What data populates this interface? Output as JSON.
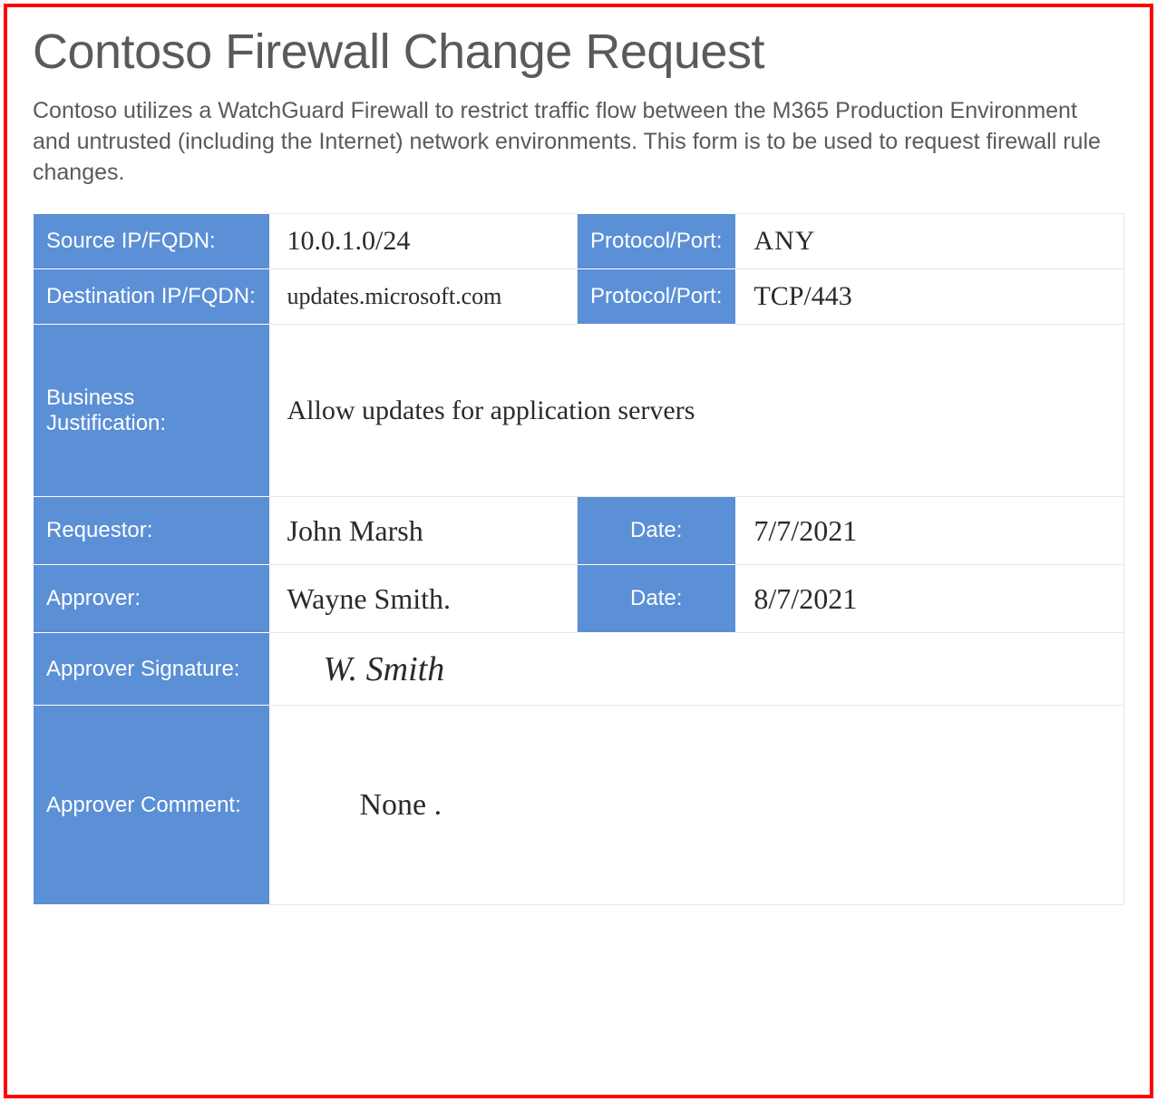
{
  "document": {
    "title": "Contoso Firewall Change Request",
    "description": "Contoso utilizes a WatchGuard Firewall to restrict traffic flow between the M365 Production Environment and untrusted (including the Internet) network environments.  This form is to be used to request firewall rule changes."
  },
  "labels": {
    "source_ip": "Source IP/FQDN:",
    "dest_ip": "Destination IP/FQDN:",
    "protocol_port": "Protocol/Port:",
    "business_justification": "Business Justification:",
    "requestor": "Requestor:",
    "approver": "Approver:",
    "date": "Date:",
    "approver_signature": "Approver Signature:",
    "approver_comment": "Approver Comment:"
  },
  "values": {
    "source_ip": "10.0.1.0/24",
    "source_protocol_port": "ANY",
    "dest_ip": "updates.microsoft.com",
    "dest_protocol_port": "TCP/443",
    "business_justification": "Allow updates for application servers",
    "requestor": "John Marsh",
    "requestor_date": "7/7/2021",
    "approver": "Wayne Smith.",
    "approver_date": "8/7/2021",
    "approver_signature": "W. Smith",
    "approver_comment": "None ."
  }
}
